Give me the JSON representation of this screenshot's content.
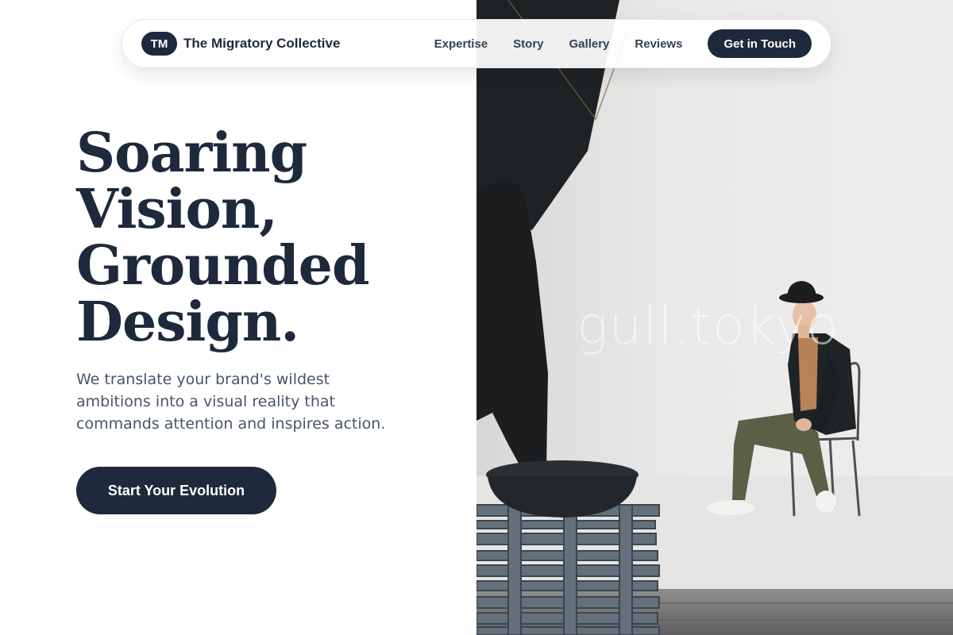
{
  "nav": {
    "logo_initials": "TM",
    "brand_name": "The Migratory Collective",
    "links": [
      "Expertise",
      "Story",
      "Gallery",
      "Reviews"
    ],
    "cta_label": "Get in Touch"
  },
  "hero": {
    "title_lines": [
      "Soaring",
      "Vision,",
      "Grounded",
      "Design."
    ],
    "subtitle": "We translate your brand's wildest ambitions into a visual reality that commands attention and inspires action.",
    "cta_label": "Start Your Evolution"
  },
  "photo": {
    "watermark": "gull.tokyo"
  },
  "colors": {
    "primary": "#1e293b",
    "text_muted": "#475569",
    "background": "#ffffff"
  }
}
